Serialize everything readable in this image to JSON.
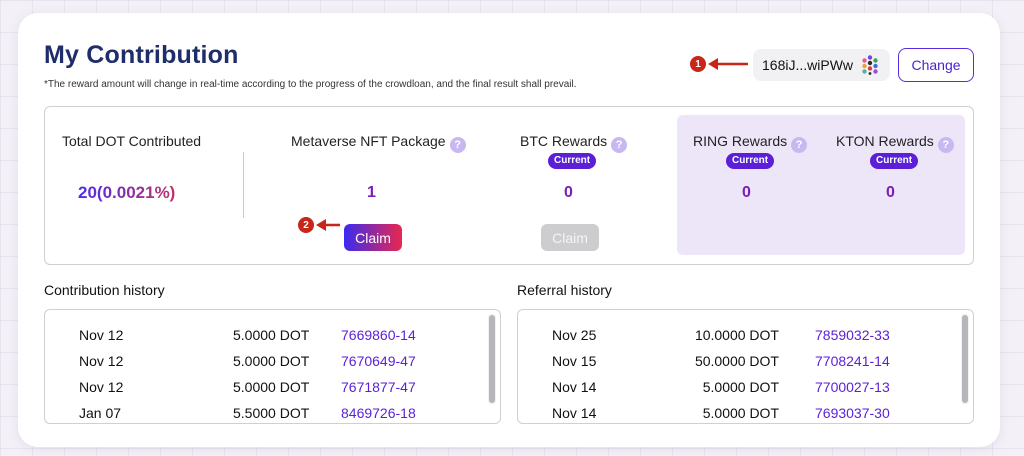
{
  "header": {
    "title": "My Contribution",
    "subtitle": "*The reward amount will change in real-time according to the progress of the crowdloan, and the final result shall prevail.",
    "address": "168iJ...wiPWw",
    "change_label": "Change",
    "markers": [
      "1",
      "2"
    ]
  },
  "stats": {
    "total": {
      "label": "Total DOT Contributed",
      "value": "20(0.0021%)"
    },
    "nft": {
      "label": "Metaverse NFT Package",
      "value": "1",
      "claim_label": "Claim"
    },
    "btc": {
      "label": "BTC Rewards",
      "badge": "Current",
      "value": "0",
      "claim_label": "Claim"
    },
    "ring": {
      "label": "RING Rewards",
      "badge": "Current",
      "value": "0"
    },
    "kton": {
      "label": "KTON Rewards",
      "badge": "Current",
      "value": "0"
    },
    "help_glyph": "?"
  },
  "contribution_history": {
    "title": "Contribution history",
    "rows": [
      {
        "date": "Nov 12",
        "amount": "5.0000 DOT",
        "hash": "7669860-14"
      },
      {
        "date": "Nov 12",
        "amount": "5.0000 DOT",
        "hash": "7670649-47"
      },
      {
        "date": "Nov 12",
        "amount": "5.0000 DOT",
        "hash": "7671877-47"
      },
      {
        "date": "Jan 07",
        "amount": "5.5000 DOT",
        "hash": "8469726-18"
      }
    ]
  },
  "referral_history": {
    "title": "Referral history",
    "rows": [
      {
        "date": "Nov 25",
        "amount": "10.0000 DOT",
        "hash": "7859032-33"
      },
      {
        "date": "Nov 15",
        "amount": "50.0000 DOT",
        "hash": "7708241-14"
      },
      {
        "date": "Nov 14",
        "amount": "5.0000 DOT",
        "hash": "7700027-13"
      },
      {
        "date": "Nov 14",
        "amount": "5.0000 DOT",
        "hash": "7693037-30"
      }
    ]
  },
  "colors": {
    "accent": "#5a1fd6",
    "title": "#1f2d6b",
    "value": "#7a1fb5",
    "marker": "#c8261b",
    "rewards_bg": "#ece6f8"
  },
  "icons": [
    "arrow-left-icon",
    "polkadot-identicon",
    "help-icon"
  ]
}
